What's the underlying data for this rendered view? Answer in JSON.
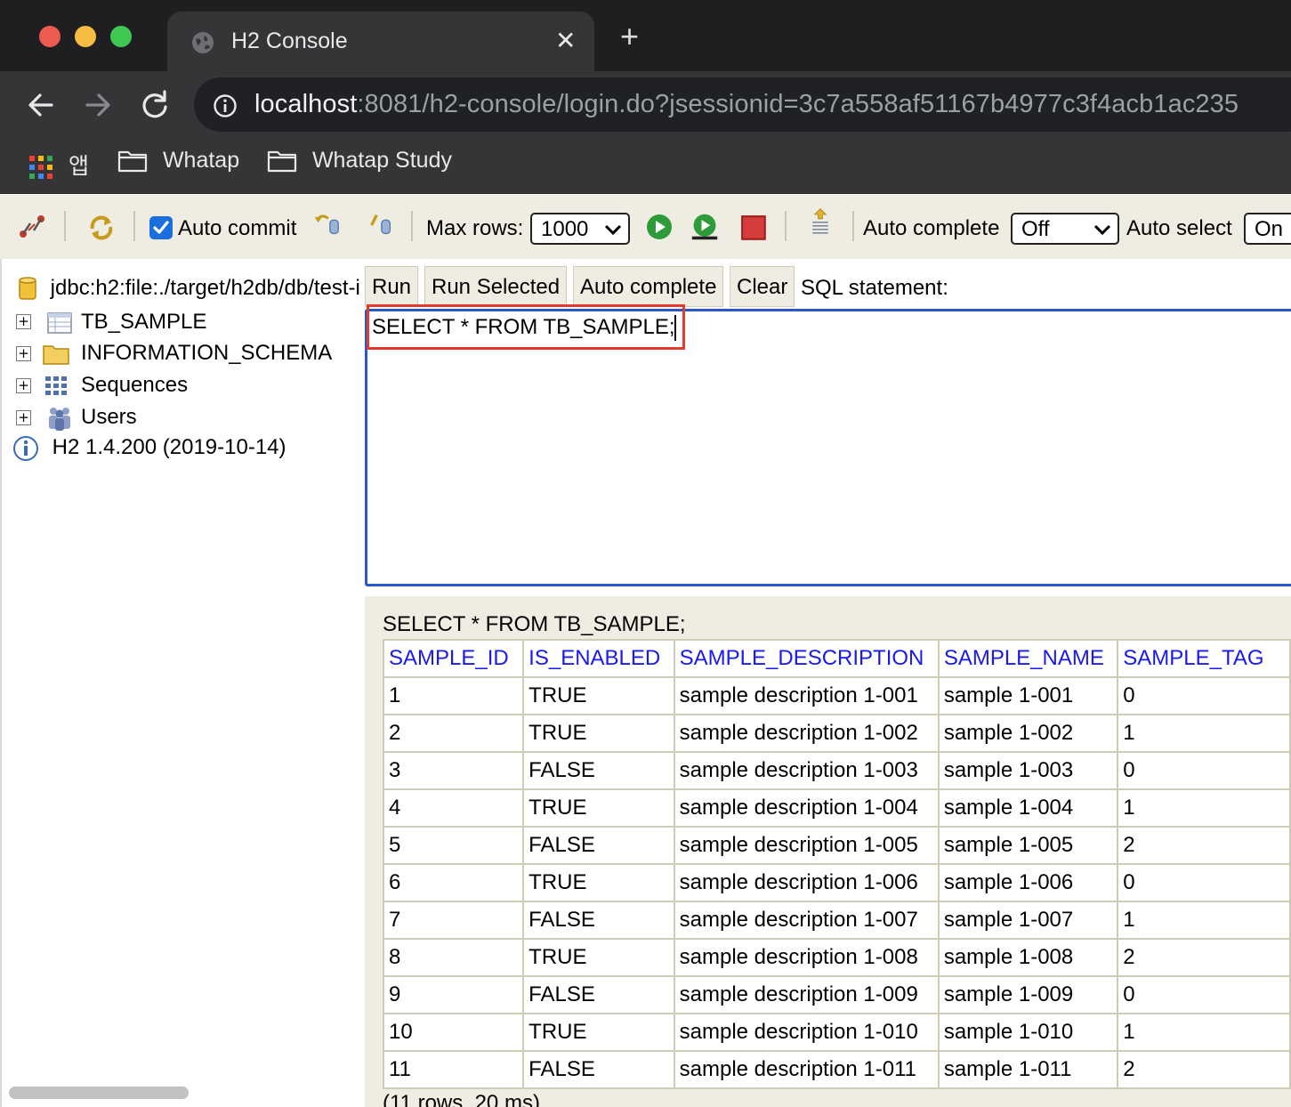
{
  "browser": {
    "tab_title": "H2 Console",
    "url_host": "localhost",
    "url_rest": ":8081/h2-console/login.do?jsessionid=3c7a558af51167b4977c3f4acb1ac235",
    "bookmarks": [
      {
        "label": "앱",
        "icon": "apps-grid-icon"
      },
      {
        "label": "Whatap",
        "icon": "folder-icon"
      },
      {
        "label": "Whatap Study",
        "icon": "folder-icon"
      }
    ],
    "colors": {
      "close": "#ee5a52",
      "minimize": "#f4bd41",
      "maximize": "#3fc952"
    }
  },
  "toolbar": {
    "auto_commit_label": "Auto commit",
    "auto_commit_checked": true,
    "max_rows_label": "Max rows:",
    "max_rows_value": "1000",
    "auto_complete_label": "Auto complete",
    "auto_complete_value": "Off",
    "auto_select_label": "Auto select",
    "auto_select_value": "On"
  },
  "tree": {
    "connection": "jdbc:h2:file:./target/h2db/db/test-i",
    "items": [
      {
        "label": "TB_SAMPLE",
        "icon": "table-icon"
      },
      {
        "label": "INFORMATION_SCHEMA",
        "icon": "folder-icon"
      },
      {
        "label": "Sequences",
        "icon": "sequences-icon"
      },
      {
        "label": "Users",
        "icon": "users-icon"
      }
    ],
    "version": "H2 1.4.200 (2019-10-14)"
  },
  "commands": {
    "run": "Run",
    "run_selected": "Run Selected",
    "auto_complete": "Auto complete",
    "clear": "Clear",
    "sql_label": "SQL statement:"
  },
  "editor": {
    "sql": "SELECT * FROM TB_SAMPLE;"
  },
  "results": {
    "query": "SELECT * FROM TB_SAMPLE;",
    "columns": [
      "SAMPLE_ID",
      "IS_ENABLED",
      "SAMPLE_DESCRIPTION",
      "SAMPLE_NAME",
      "SAMPLE_TAG"
    ],
    "rows": [
      [
        "1",
        "TRUE",
        "sample description 1-001",
        "sample 1-001",
        "0"
      ],
      [
        "2",
        "TRUE",
        "sample description 1-002",
        "sample 1-002",
        "1"
      ],
      [
        "3",
        "FALSE",
        "sample description 1-003",
        "sample 1-003",
        "0"
      ],
      [
        "4",
        "TRUE",
        "sample description 1-004",
        "sample 1-004",
        "1"
      ],
      [
        "5",
        "FALSE",
        "sample description 1-005",
        "sample 1-005",
        "2"
      ],
      [
        "6",
        "TRUE",
        "sample description 1-006",
        "sample 1-006",
        "0"
      ],
      [
        "7",
        "FALSE",
        "sample description 1-007",
        "sample 1-007",
        "1"
      ],
      [
        "8",
        "TRUE",
        "sample description 1-008",
        "sample 1-008",
        "2"
      ],
      [
        "9",
        "FALSE",
        "sample description 1-009",
        "sample 1-009",
        "0"
      ],
      [
        "10",
        "TRUE",
        "sample description 1-010",
        "sample 1-010",
        "1"
      ],
      [
        "11",
        "FALSE",
        "sample description 1-011",
        "sample 1-011",
        "2"
      ]
    ],
    "footer": "(11 rows, 20 ms)"
  }
}
